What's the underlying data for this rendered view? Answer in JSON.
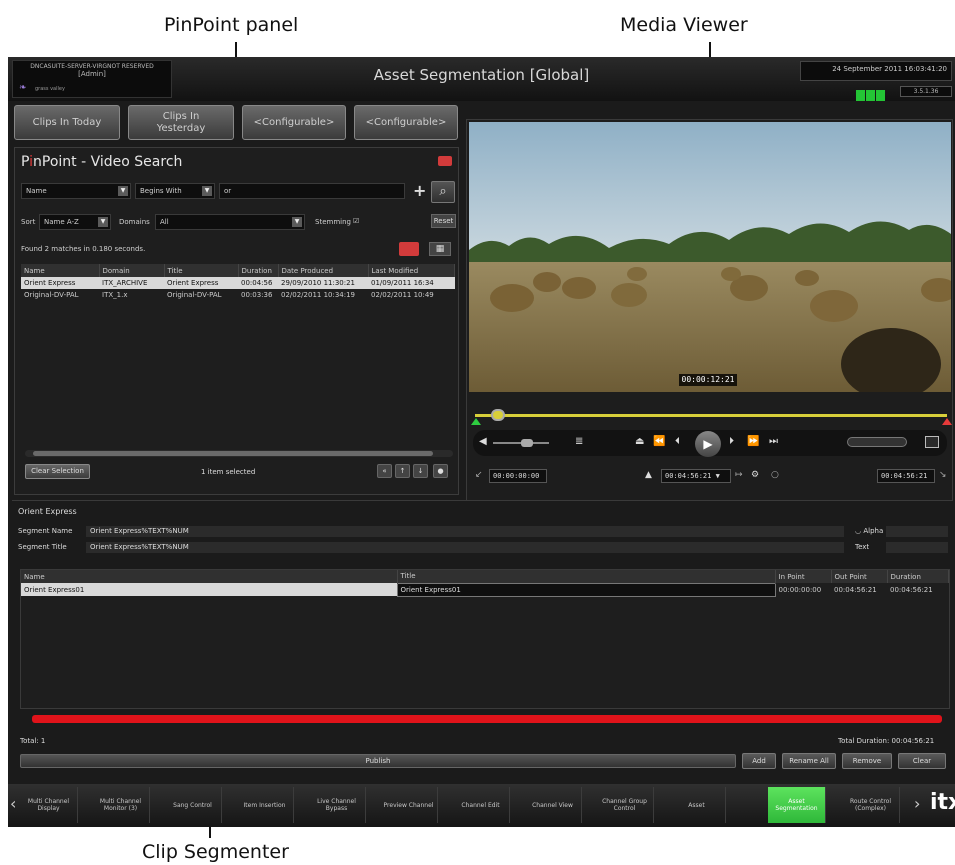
{
  "annotations": {
    "pinpoint_panel": "PinPoint panel",
    "media_viewer": "Media Viewer",
    "clip_segmenter": "Clip Segmenter"
  },
  "titlebar": {
    "logo_line1": "DNCASUITE-SERVER-VIRGNOT RESERVED",
    "logo_line2": "[Admin]",
    "logo_brand": "grass valley",
    "title": "Asset Segmentation [Global]",
    "datetime": "24 September 2011 16:03:41:20",
    "version": "3.5.1.36"
  },
  "quick_buttons": [
    "Clips In Today",
    "Clips In Yesterday",
    "<Configurable>",
    "<Configurable>"
  ],
  "pinpoint": {
    "title_pre": "P",
    "title_i": "i",
    "title_post": "nPoint - Video Search",
    "field_select": "Name",
    "operator_select": "Begins With",
    "search_value": "or",
    "sort_label": "Sort",
    "sort_select": "Name A-Z",
    "domains_label": "Domains",
    "domains_select": "All",
    "stemming_label": "Stemming",
    "reset_label": "Reset",
    "found_text": "Found 2 matches in 0.180 seconds.",
    "columns": [
      "Name",
      "Domain",
      "Title",
      "Duration",
      "Date Produced",
      "Last Modified"
    ],
    "rows": [
      [
        "Orient Express",
        "ITX_ARCHIVE",
        "Orient Express",
        "00:04:56",
        "29/09/2010 11:30:21",
        "01/09/2011 16:34"
      ],
      [
        "Original-DV-PAL",
        "ITX_1.x",
        "Original-DV-PAL",
        "00:03:36",
        "02/02/2011 10:34:19",
        "02/02/2011 10:49"
      ]
    ],
    "clear_selection": "Clear Selection",
    "items_selected": "1 item selected"
  },
  "viewer": {
    "overlay_timecode": "00:00:12:21",
    "tc_in": "00:00:00:00",
    "tc_duration": "00:04:56:21",
    "tc_out": "00:04:56:21"
  },
  "segmenter": {
    "header": "Orient Express",
    "segment_name_label": "Segment Name",
    "segment_name_value": "Orient Express%TEXT%NUM",
    "segment_title_label": "Segment Title",
    "segment_title_value": "Orient Express%TEXT%NUM",
    "alpha_label": "Alpha",
    "text_label": "Text",
    "columns": [
      "Name",
      "Title",
      "In Point",
      "Out Point",
      "Duration"
    ],
    "rows": [
      [
        "Orient Express01",
        "Orient Express01",
        "00:00:00:00",
        "00:04:56:21",
        "00:04:56:21"
      ]
    ],
    "total_label": "Total: 1",
    "total_duration": "Total Duration: 00:04:56:21",
    "publish": "Publish",
    "buttons": [
      "Add",
      "Rename All",
      "Remove",
      "Clear"
    ]
  },
  "nav": {
    "items": [
      "Multi Channel Display",
      "Multi Channel Monitor (3)",
      "Sang Control",
      "Item Insertion",
      "Live Channel Bypass",
      "Preview Channel",
      "Channel Edit",
      "Channel View",
      "Channel Group Control",
      "Asset",
      "Asset Segmentation",
      "Route Control (Complex)"
    ],
    "active": "Asset Segmentation",
    "brand": "itx"
  },
  "colors": {
    "accent_green": "#23c435",
    "accent_red": "#e0131a",
    "scrub_yellow": "#d8cf3a"
  }
}
